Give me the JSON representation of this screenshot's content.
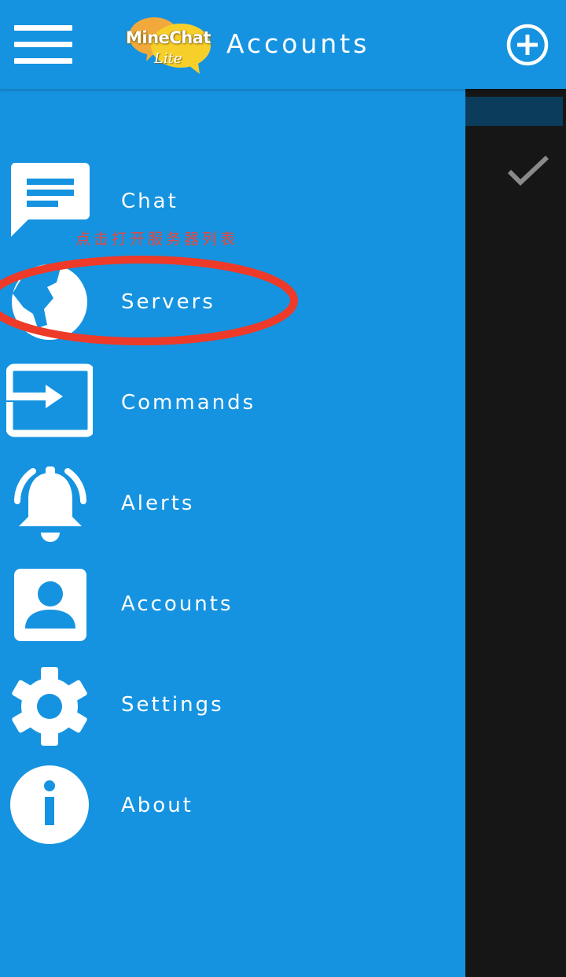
{
  "app": {
    "logo_text": "MineChat",
    "logo_sub": "Lite",
    "title": "Accounts"
  },
  "colors": {
    "primary": "#1593e0",
    "background": "#161616",
    "annotation": "#e8463a"
  },
  "drawer": {
    "items": [
      {
        "label": "Chat",
        "icon": "chat-icon"
      },
      {
        "label": "Servers",
        "icon": "globe-icon"
      },
      {
        "label": "Commands",
        "icon": "input-arrow-icon"
      },
      {
        "label": "Alerts",
        "icon": "bell-icon"
      },
      {
        "label": "Accounts",
        "icon": "account-box-icon"
      },
      {
        "label": "Settings",
        "icon": "gear-icon"
      },
      {
        "label": "About",
        "icon": "info-icon"
      }
    ]
  },
  "annotation": {
    "text": "点击打开服务器列表"
  }
}
